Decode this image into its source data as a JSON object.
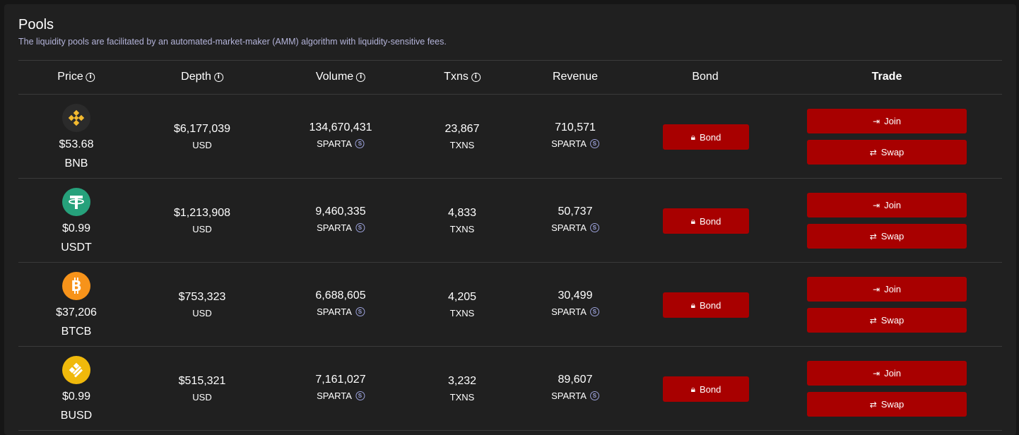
{
  "header": {
    "title": "Pools",
    "subtitle": "The liquidity pools are facilitated by an automated-market-maker (AMM) algorithm with liquidity-sensitive fees."
  },
  "columns": {
    "price": "Price",
    "depth": "Depth",
    "volume": "Volume",
    "txns": "Txns",
    "revenue": "Revenue",
    "bond": "Bond",
    "trade": "Trade"
  },
  "labels": {
    "bond_button": "Bond",
    "join_button": "Join",
    "swap_button": "Swap",
    "info_glyph": "i",
    "sparta_glyph": "S"
  },
  "colors": {
    "button": "#a80000",
    "background": "#202020",
    "accent_icon": "#9aa0d8"
  },
  "pools": [
    {
      "icon": "bnb-icon",
      "price": "$53.68",
      "symbol": "BNB",
      "depth": "$6,177,039",
      "depth_unit": "USD",
      "volume": "134,670,431",
      "volume_unit": "SPARTA",
      "txns": "23,867",
      "txns_unit": "TXNS",
      "revenue": "710,571",
      "revenue_unit": "SPARTA"
    },
    {
      "icon": "usdt-icon",
      "price": "$0.99",
      "symbol": "USDT",
      "depth": "$1,213,908",
      "depth_unit": "USD",
      "volume": "9,460,335",
      "volume_unit": "SPARTA",
      "txns": "4,833",
      "txns_unit": "TXNS",
      "revenue": "50,737",
      "revenue_unit": "SPARTA"
    },
    {
      "icon": "btcb-icon",
      "price": "$37,206",
      "symbol": "BTCB",
      "depth": "$753,323",
      "depth_unit": "USD",
      "volume": "6,688,605",
      "volume_unit": "SPARTA",
      "txns": "4,205",
      "txns_unit": "TXNS",
      "revenue": "30,499",
      "revenue_unit": "SPARTA"
    },
    {
      "icon": "busd-icon",
      "price": "$0.99",
      "symbol": "BUSD",
      "depth": "$515,321",
      "depth_unit": "USD",
      "volume": "7,161,027",
      "volume_unit": "SPARTA",
      "txns": "3,232",
      "txns_unit": "TXNS",
      "revenue": "89,607",
      "revenue_unit": "SPARTA"
    }
  ]
}
